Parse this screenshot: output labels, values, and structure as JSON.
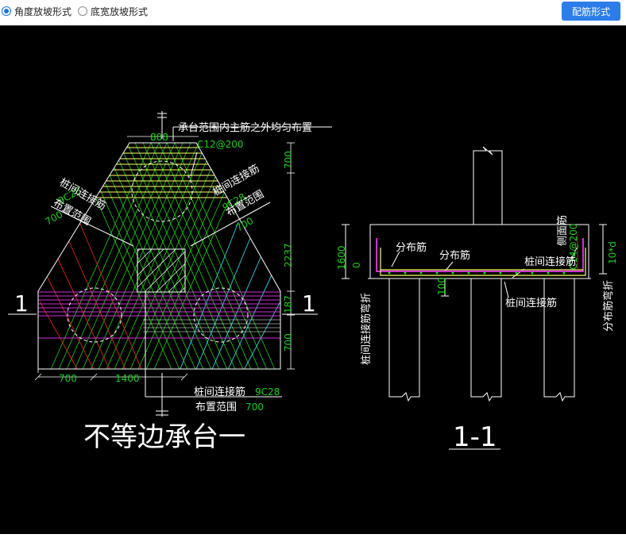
{
  "toolbar": {
    "option_angle": "角度放坡形式",
    "option_width": "底宽放坡形式",
    "selected": "angle",
    "rebar_button": "配筋形式"
  },
  "drawing": {
    "left_title": "不等边承台一",
    "right_title": "1-1",
    "section_mark": "1",
    "note_main": "承台范围内主筋之外均匀布置",
    "c12": "C12@200",
    "dim_808": "808",
    "dim_700_top": "700",
    "dim_2237": "2237",
    "dim_187": "187",
    "dim_700_bottom": "700",
    "dim_700_left": "700",
    "dim_1400": "1400",
    "left_conn": "桩间连接筋",
    "left_conn_spec": "9C28",
    "left_range": "布置范围",
    "left_range_val": "700",
    "right_conn": "桩间连接筋",
    "right_conn_spec": "9C28",
    "right_range": "布置范围",
    "right_range_val": "700",
    "bottom_conn": "桩间连接筋",
    "bottom_conn_spec": "9C28",
    "bottom_range": "布置范围",
    "bottom_range_val": "700",
    "sec_dim_1600": "1600",
    "sec_dim_0": "0",
    "sec_dim_100": "100",
    "sec_dist1": "分布筋",
    "sec_dist2": "分布筋",
    "sec_side": "侧面筋",
    "sec_c14": "C14@200",
    "sec_conn_right": "桩间连接筋",
    "sec_conn_bottom": "桩间连接筋",
    "sec_bend_left": "桩间连接筋弯折",
    "sec_bend_right": "分布筋弯折",
    "sec_10d": "10*d"
  }
}
